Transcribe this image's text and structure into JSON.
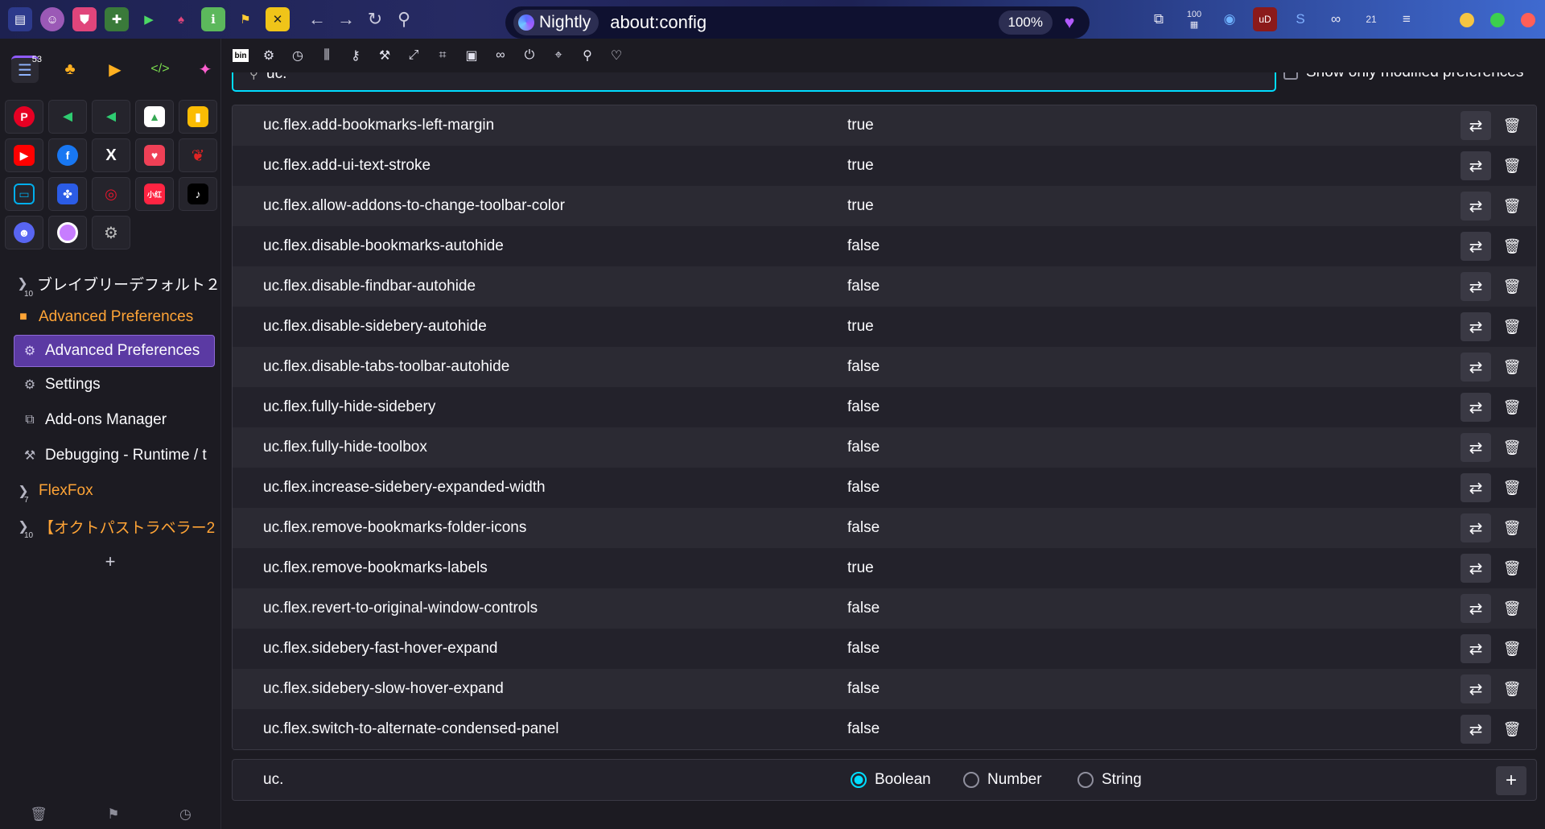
{
  "browser": {
    "identity_label": "Nightly",
    "url": "about:config",
    "zoom": "100%"
  },
  "right_toolbar": {
    "badge_100": "100",
    "calendar_day": "21"
  },
  "sidebar": {
    "tab_count": "53",
    "tree": [
      {
        "label": "ブレイブリーデフォルト２",
        "count": "10",
        "style": "group",
        "icon": "folder-arrow-icon"
      },
      {
        "label": "Advanced Preferences",
        "style": "orange",
        "icon": "folder-icon"
      },
      {
        "label": "Advanced Preferences",
        "style": "selected",
        "icon": "gear-icon"
      },
      {
        "label": "Settings",
        "style": "child",
        "icon": "gear-icon"
      },
      {
        "label": "Add-ons Manager",
        "style": "child",
        "icon": "puzzle-icon"
      },
      {
        "label": "Debugging - Runtime / t",
        "style": "child",
        "icon": "wrench-icon"
      },
      {
        "label": "FlexFox",
        "count": "7",
        "style": "group-orange",
        "icon": "folder-arrow-icon"
      },
      {
        "label": "【オクトパストラベラー2",
        "count": "10",
        "style": "group-orange",
        "icon": "folder-arrow-icon"
      }
    ],
    "new_tab": "+"
  },
  "config": {
    "search_value": "uc.",
    "show_modified_label": "Show only modified preferences",
    "prefs": [
      {
        "name": "uc.flex.add-bookmarks-left-margin",
        "value": "true"
      },
      {
        "name": "uc.flex.add-ui-text-stroke",
        "value": "true"
      },
      {
        "name": "uc.flex.allow-addons-to-change-toolbar-color",
        "value": "true"
      },
      {
        "name": "uc.flex.disable-bookmarks-autohide",
        "value": "false"
      },
      {
        "name": "uc.flex.disable-findbar-autohide",
        "value": "false"
      },
      {
        "name": "uc.flex.disable-sidebery-autohide",
        "value": "true"
      },
      {
        "name": "uc.flex.disable-tabs-toolbar-autohide",
        "value": "false"
      },
      {
        "name": "uc.flex.fully-hide-sidebery",
        "value": "false"
      },
      {
        "name": "uc.flex.fully-hide-toolbox",
        "value": "false"
      },
      {
        "name": "uc.flex.increase-sidebery-expanded-width",
        "value": "false"
      },
      {
        "name": "uc.flex.remove-bookmarks-folder-icons",
        "value": "false"
      },
      {
        "name": "uc.flex.remove-bookmarks-labels",
        "value": "true"
      },
      {
        "name": "uc.flex.revert-to-original-window-controls",
        "value": "false"
      },
      {
        "name": "uc.flex.sidebery-fast-hover-expand",
        "value": "false"
      },
      {
        "name": "uc.flex.sidebery-slow-hover-expand",
        "value": "false"
      },
      {
        "name": "uc.flex.switch-to-alternate-condensed-panel",
        "value": "false"
      }
    ],
    "new_pref": {
      "name": "uc.",
      "types": [
        "Boolean",
        "Number",
        "String"
      ],
      "selected": "Boolean"
    }
  },
  "colors": {
    "accent": "#00ddff",
    "selected_tab": "#5b3aa3",
    "folder_orange": "#ffa436"
  }
}
